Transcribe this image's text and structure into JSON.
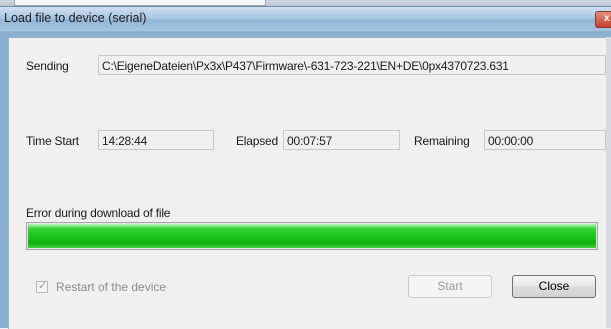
{
  "window": {
    "title": "Load file to device (serial)",
    "close_glyph": "x"
  },
  "sending": {
    "label": "Sending",
    "path": "C:\\EigeneDateien\\Px3x\\P437\\Firmware\\-631-723-221\\EN+DE\\0px4370723.631"
  },
  "timing": {
    "start_label": "Time Start",
    "start_value": "14:28:44",
    "elapsed_label": "Elapsed",
    "elapsed_value": "00:07:57",
    "remaining_label": "Remaining",
    "remaining_value": "00:00:00"
  },
  "status": {
    "message": "Error during download of file",
    "progress_percent": 100
  },
  "options": {
    "restart_label": "Restart of the device",
    "restart_checked": true
  },
  "buttons": {
    "start_label": "Start",
    "close_label": "Close"
  },
  "icons": {
    "check": "✓"
  },
  "colors": {
    "progress": "#18c418",
    "titlebar": "#a9c6e3"
  }
}
